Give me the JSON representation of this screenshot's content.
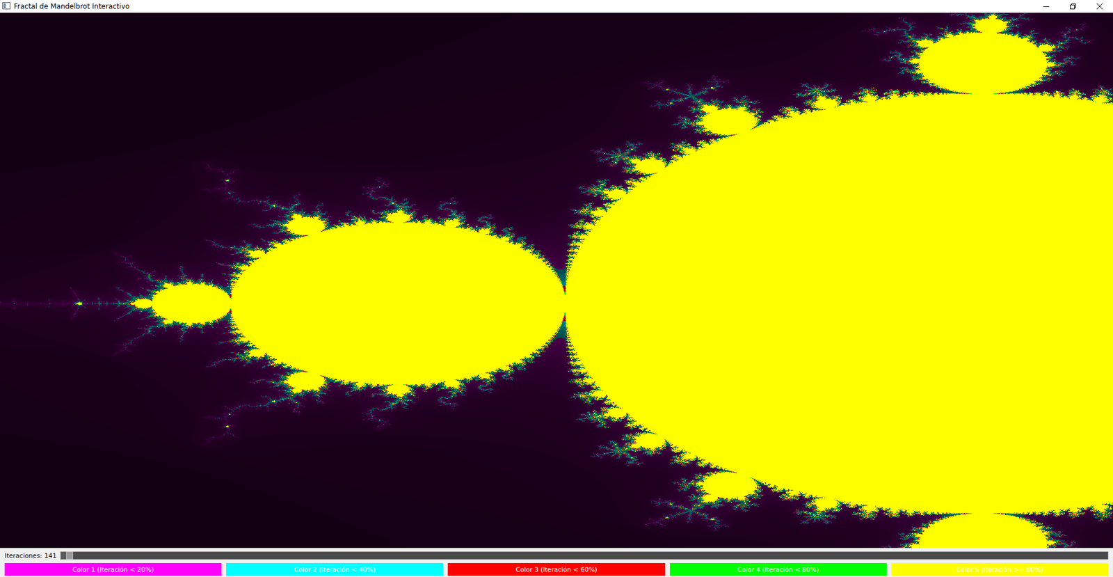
{
  "window": {
    "title": "Fractal de Mandelbrot Interactivo"
  },
  "iterations": {
    "label": "Iteraciones:",
    "value": "141",
    "level": 0.005
  },
  "palette": [
    {
      "label": "Color 1 (Iteración < 20%)",
      "color": "#ff00ff"
    },
    {
      "label": "Color 2 (Iteración < 40%)",
      "color": "#00ffff"
    },
    {
      "label": "Color 3 (Iteración < 60%)",
      "color": "#ff0000"
    },
    {
      "label": "Color 4 (Iteración < 80%)",
      "color": "#00ff00"
    },
    {
      "label": "Color 5 (Iteración >= 80%)",
      "color": "#ffff00"
    }
  ]
}
